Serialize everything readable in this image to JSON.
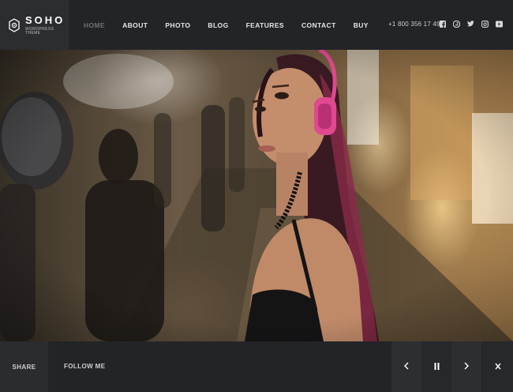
{
  "brand": {
    "title": "SOHO",
    "subtitle": "WORDPRESS THEME",
    "logo_icon": "gear-flower-icon"
  },
  "nav": {
    "items": [
      {
        "label": "HOME",
        "active": true
      },
      {
        "label": "ABOUT",
        "active": false
      },
      {
        "label": "PHOTO",
        "active": false
      },
      {
        "label": "BLOG",
        "active": false
      },
      {
        "label": "FEATURES",
        "active": false
      },
      {
        "label": "CONTACT",
        "active": false
      },
      {
        "label": "BUY",
        "active": false
      }
    ]
  },
  "phone": "+1 800 356 17 49",
  "social": [
    "facebook-icon",
    "pinterest-icon",
    "twitter-icon",
    "instagram-icon",
    "youtube-icon"
  ],
  "hero": {
    "image": "woman-with-pink-headphones-in-rainy-street"
  },
  "footer": {
    "share_label": "SHARE",
    "follow_label": "FOLLOW ME",
    "controls": [
      "prev-arrow-icon",
      "pause-icon",
      "next-arrow-icon",
      "close-icon"
    ]
  },
  "colors": {
    "header_bg": "#232427",
    "logo_bg": "#2c2d30",
    "active_nav": "#6f7174",
    "headphones": "#e0488f"
  }
}
